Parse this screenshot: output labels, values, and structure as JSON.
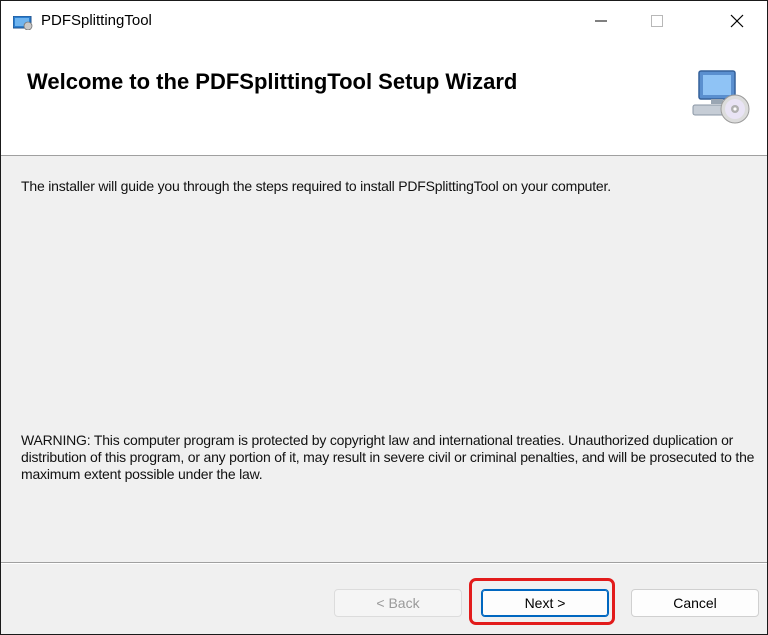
{
  "window": {
    "title": "PDFSplittingTool",
    "controls": {
      "minimize": "—",
      "maximize": "☐",
      "close": "✕"
    }
  },
  "header": {
    "title": "Welcome to the PDFSplittingTool Setup Wizard",
    "icon": "computer-cd-icon"
  },
  "body": {
    "intro": "The installer will guide you through the steps required to install PDFSplittingTool on your computer.",
    "warning": "WARNING: This computer program is protected by copyright law and international treaties. Unauthorized duplication or distribution of this program, or any portion of it, may result in severe civil or criminal penalties, and will be prosecuted to the maximum extent possible under the law."
  },
  "buttons": {
    "back": "< Back",
    "next": "Next >",
    "cancel": "Cancel"
  },
  "colors": {
    "highlight": "#e21b1b",
    "default_button_border": "#0067c0"
  }
}
